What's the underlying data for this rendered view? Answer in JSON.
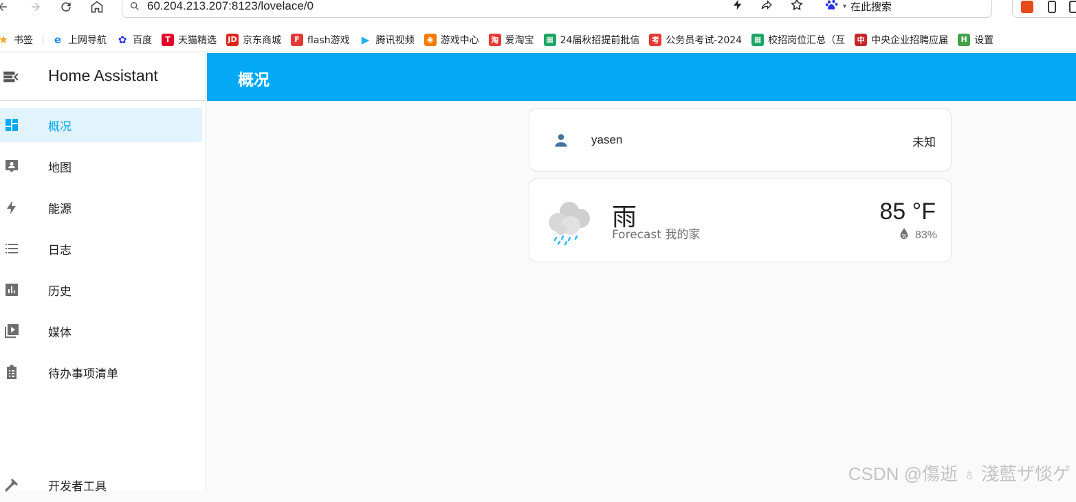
{
  "browser": {
    "url": "60.204.213.207:8123/lovelace/0",
    "search_placeholder": "在此搜索",
    "bookmarks": [
      {
        "label": "书签",
        "icon": "star-icon",
        "color": "#f5a623"
      },
      {
        "label": "上网导航",
        "icon": "ie-icon",
        "color": "#1e88e5"
      },
      {
        "label": "百度",
        "icon": "baidu-paw-icon",
        "color": "#2932e1"
      },
      {
        "label": "天猫精选",
        "icon": "tmall-icon",
        "color": "#e4002b"
      },
      {
        "label": "京东商城",
        "icon": "jd-icon",
        "color": "#e1251b"
      },
      {
        "label": "flash游戏",
        "icon": "flash-icon",
        "color": "#e53935"
      },
      {
        "label": "腾讯视频",
        "icon": "play-icon",
        "color": "#20b0f0"
      },
      {
        "label": "游戏中心",
        "icon": "gamepad-icon",
        "color": "#f57c00"
      },
      {
        "label": "爱淘宝",
        "icon": "taobao-icon",
        "color": "#e53935"
      },
      {
        "label": "24届秋招提前批信",
        "icon": "sheet-icon",
        "color": "#1fa463"
      },
      {
        "label": "公务员考试-2024",
        "icon": "exam-icon",
        "color": "#e53935"
      },
      {
        "label": "校招岗位汇总（互",
        "icon": "sheet-icon",
        "color": "#1fa463"
      },
      {
        "label": "中央企业招聘应届",
        "icon": "soe-icon",
        "color": "#c62828"
      },
      {
        "label": "设置",
        "icon": "settings-h-icon",
        "color": "#43a047"
      }
    ]
  },
  "app": {
    "title": "Home Assistant",
    "view_title": "概况",
    "accent": "#03a9f4",
    "sidebar": {
      "items": [
        {
          "label": "概况",
          "icon": "dashboard-icon",
          "active": true
        },
        {
          "label": "地图",
          "icon": "map-person-icon",
          "active": false
        },
        {
          "label": "能源",
          "icon": "lightning-icon",
          "active": false
        },
        {
          "label": "日志",
          "icon": "list-icon",
          "active": false
        },
        {
          "label": "历史",
          "icon": "chart-bar-icon",
          "active": false
        },
        {
          "label": "媒体",
          "icon": "media-icon",
          "active": false
        },
        {
          "label": "待办事项清单",
          "icon": "clipboard-list-icon",
          "active": false
        }
      ],
      "bottom_item": {
        "label": "开发者工具",
        "icon": "hammer-icon"
      }
    },
    "cards": {
      "person": {
        "name": "yasen",
        "state": "未知",
        "icon": "account-icon"
      },
      "weather": {
        "condition": "雨",
        "forecast_name": "Forecast 我的家",
        "temperature": "85 °F",
        "humidity": "83%",
        "icon": "rainy-cloud-icon"
      }
    }
  },
  "watermark": "CSDN @傷逝 ♁ 淺藍ザ惔ゲ"
}
